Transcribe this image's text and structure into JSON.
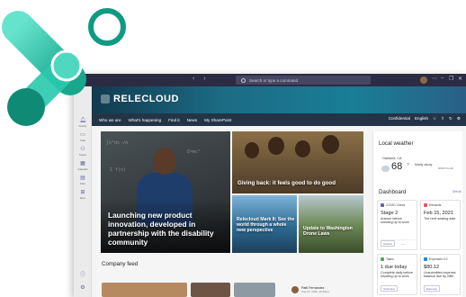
{
  "titlebar": {
    "nav_arrows": "‹ ›",
    "search_placeholder": "Search or type a command",
    "window_controls": [
      "⋯",
      "–",
      "❐",
      "✕"
    ]
  },
  "rail": {
    "items": [
      {
        "icon": "bell-icon",
        "label": "Activity"
      },
      {
        "icon": "chat-icon",
        "label": "Chat"
      },
      {
        "icon": "teams-icon",
        "label": "Teams"
      },
      {
        "icon": "calendar-icon",
        "label": "Calendar"
      },
      {
        "icon": "files-icon",
        "label": "Files"
      },
      {
        "icon": "apps-icon",
        "label": "More"
      },
      {
        "icon": "help-icon",
        "label": ""
      },
      {
        "icon": "settings-icon",
        "label": ""
      }
    ]
  },
  "site": {
    "title": "RELECLOUD",
    "nav": [
      "Who we are",
      "What's happening",
      "Find it",
      "News",
      "My SharePoint"
    ],
    "nav_right": {
      "classification": "Confidential",
      "language": "English"
    }
  },
  "news": {
    "main": "Launching new product innovation, developed in partnership with the disability community",
    "top_right": "Giving back: it feels good to do good",
    "bottom_left": "Relecloud Mark 8: See the world through a whole new perspective",
    "bottom_right": "Update to Washington Drone Laws"
  },
  "feed": {
    "title": "Company feed",
    "author": "Patti Fernandez",
    "date": "Aug 27, 2020, 12:00pm"
  },
  "weather": {
    "title": "Local weather",
    "location": "Oakland, CA",
    "temp": "68",
    "unit": "°F",
    "condition": "Mostly cloudy",
    "wind": "NNW 5 km/h",
    "icon": "cloud-icon"
  },
  "dashboard": {
    "title": "Dashboard",
    "see_all": "See all",
    "cards": [
      {
        "app": "COVID Check",
        "big": "Stage 2",
        "text": "Answer before showing up to work",
        "action": "Upload",
        "color": "#6264a7"
      },
      {
        "app": "Rewards",
        "big": "Feb 15, 2021",
        "text": "The next seating date",
        "action": "",
        "color": "#e05a5a"
      },
      {
        "app": "Tasks",
        "big": "1 due today",
        "text": "Complete daily before showing up to work",
        "action": "Overview",
        "color": "#4caf50"
      },
      {
        "app": "Expenses 0.0",
        "big": "$80.12",
        "text": "Unsubmitted expense balance due by 28th",
        "action": "Expense",
        "color": "#1e88e5"
      }
    ]
  },
  "colors": {
    "titlebar": "#2b2b43",
    "site_banner": "#1c6b85",
    "site_nav": "#243447",
    "teams_accent": "#6264a7",
    "logo_dark": "#0f8a74",
    "logo_light": "#5ce0c6"
  }
}
